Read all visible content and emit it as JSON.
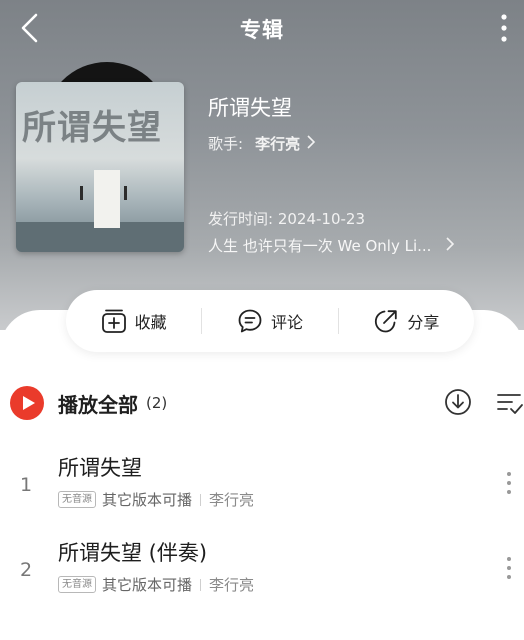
{
  "header": {
    "title": "专辑"
  },
  "album": {
    "name": "所谓失望",
    "artist_label": "歌手:",
    "artist_name": "李行亮",
    "release": "发行时间: 2024-10-23",
    "description": "人生 也许只有一次 We Only Li...",
    "cover_text": "所谓失望"
  },
  "actions": {
    "collect": "收藏",
    "comment": "评论",
    "share": "分享"
  },
  "playall": {
    "label": "播放全部",
    "count": "(2)"
  },
  "tracks": [
    {
      "num": "1",
      "name": "所谓失望",
      "tag": "无音源",
      "note": "其它版本可播",
      "artist": "李行亮"
    },
    {
      "num": "2",
      "name": "所谓失望 (伴奏)",
      "tag": "无音源",
      "note": "其它版本可播",
      "artist": "李行亮"
    }
  ],
  "colors": {
    "accent": "#ea3b2b",
    "hero_top": "#7d8287",
    "text_dark": "#1e1e1e"
  },
  "icons": [
    "back-icon",
    "more-vertical-icon",
    "collect-icon",
    "comment-icon",
    "share-icon",
    "play-icon",
    "download-icon",
    "multi-select-icon",
    "chevron-right-icon"
  ]
}
